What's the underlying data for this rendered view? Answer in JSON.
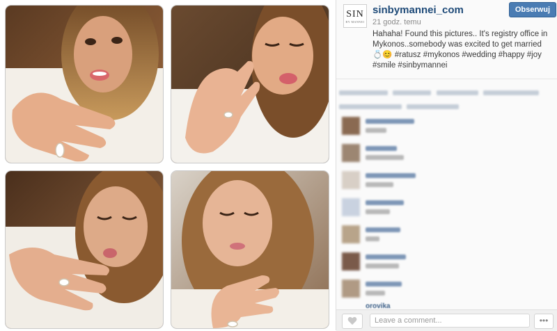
{
  "post": {
    "username": "sinbymannei_com",
    "timestamp": "21 godz. temu",
    "follow_label": "Obserwuj",
    "logo_text": "SIN",
    "logo_subtext": "BY MANNEI",
    "caption_text": "Hahaha! Found this pictures.. It's registry office in Mykonos..somebody was excited to get married 💍😊",
    "hashtags": [
      "#ratusz",
      "#mykonos",
      "#wedding",
      "#happy",
      "#joy",
      "#smile",
      "#sinbymannei"
    ]
  },
  "photos": [
    {
      "name": "photo-top-left"
    },
    {
      "name": "photo-top-right"
    },
    {
      "name": "photo-bottom-left"
    },
    {
      "name": "photo-bottom-right"
    }
  ],
  "comments": {
    "partial_visible_name": "orovika"
  },
  "footer": {
    "comment_placeholder": "Leave a comment...",
    "like_icon": "heart-icon",
    "more_icon": "ellipsis-icon"
  },
  "colors": {
    "username": "#1e4a78",
    "follow_button": "#4a7cb3",
    "sidebar_bg": "#fafafa"
  }
}
